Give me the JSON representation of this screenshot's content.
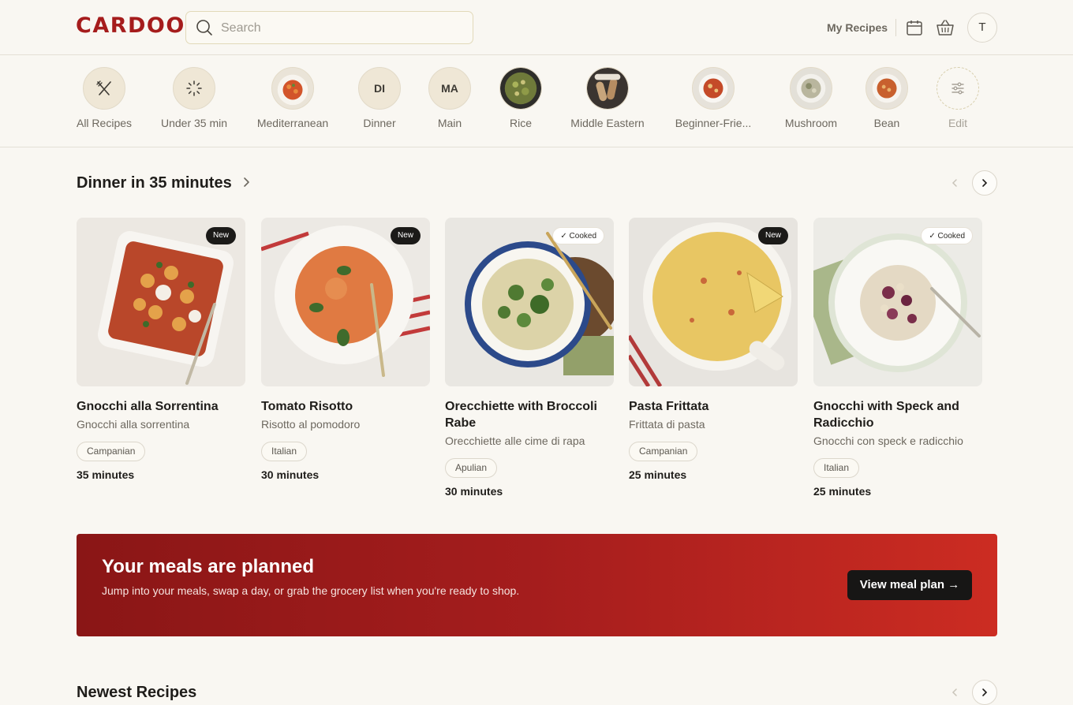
{
  "brand": {
    "logo": "CARDOON",
    "accent": "#a51c1c"
  },
  "header": {
    "search_placeholder": "Search",
    "my_recipes": "My Recipes",
    "avatar_initial": "T",
    "icons": [
      "search-icon",
      "calendar-icon",
      "basket-icon"
    ]
  },
  "categories": [
    {
      "label": "All Recipes",
      "icon": "utensils-crossed-icon"
    },
    {
      "label": "Under 35 min",
      "icon": "loader-icon"
    },
    {
      "label": "Mediterranean",
      "icon": "food-photo"
    },
    {
      "label": "Dinner",
      "initials": "DI"
    },
    {
      "label": "Main",
      "initials": "MA"
    },
    {
      "label": "Rice",
      "icon": "food-photo"
    },
    {
      "label": "Middle Eastern",
      "icon": "food-photo"
    },
    {
      "label": "Beginner-Frie...",
      "icon": "food-photo"
    },
    {
      "label": "Mushroom",
      "icon": "food-photo"
    },
    {
      "label": "Bean",
      "icon": "food-photo"
    },
    {
      "label": "Edit",
      "icon": "sliders-icon"
    }
  ],
  "section1": {
    "title": "Dinner in 35 minutes",
    "cards": [
      {
        "title": "Gnocchi alla Sorrentina",
        "subtitle": "Gnocchi alla sorrentina",
        "tag": "Campanian",
        "time": "35 minutes",
        "badge": "New"
      },
      {
        "title": "Tomato Risotto",
        "subtitle": "Risotto al pomodoro",
        "tag": "Italian",
        "time": "30 minutes",
        "badge": "New"
      },
      {
        "title": "Orecchiette with Broccoli Rabe",
        "subtitle": "Orecchiette alle cime di rapa",
        "tag": "Apulian",
        "time": "30 minutes",
        "badge": "Cooked"
      },
      {
        "title": "Pasta Frittata",
        "subtitle": "Frittata di pasta",
        "tag": "Campanian",
        "time": "25 minutes",
        "badge": "New"
      },
      {
        "title": "Gnocchi with Speck and Radicchio",
        "subtitle": "Gnocchi con speck e radicchio",
        "tag": "Italian",
        "time": "25 minutes",
        "badge": "Cooked"
      }
    ]
  },
  "banner": {
    "title": "Your meals are planned",
    "description": "Jump into your meals, swap a day, or grab the grocery list when you're ready to shop.",
    "button": "View meal plan →"
  },
  "section2": {
    "title": "Newest Recipes"
  }
}
